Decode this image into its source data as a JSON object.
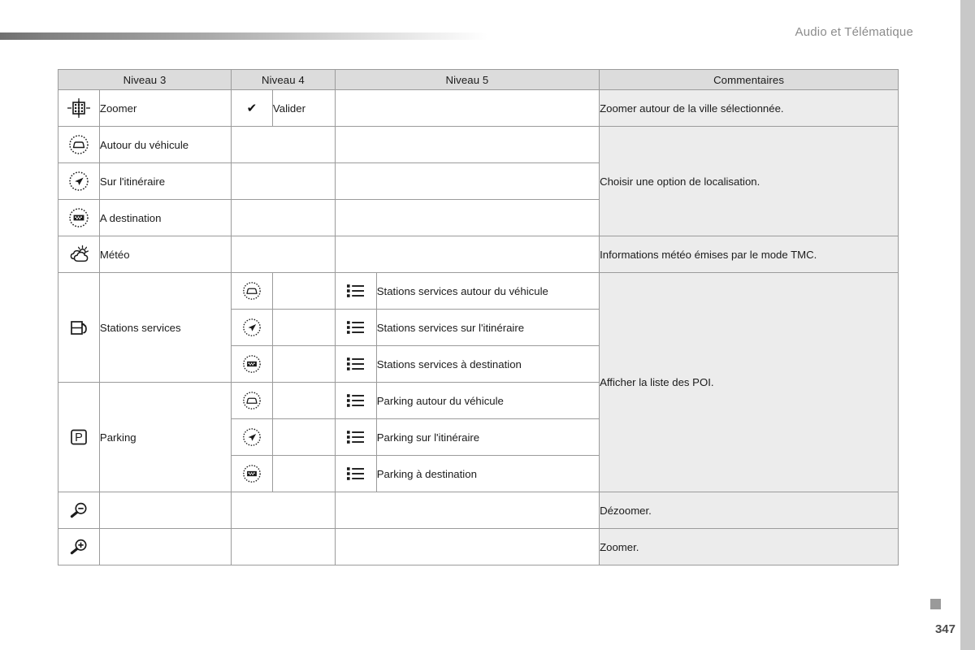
{
  "header": {
    "title": "Audio et Télématique"
  },
  "footer": {
    "page_number": "347"
  },
  "table": {
    "columns": [
      "Niveau 3",
      "Niveau 4",
      "Niveau 5",
      "Commentaires"
    ],
    "rows": [
      {
        "n3_icon": "zoom-city-icon",
        "n3_label": "Zoomer",
        "n4_icon": "check-icon",
        "n4_label": "Valider",
        "n5_icon": "",
        "n5_label": "",
        "comment": "Zoomer autour de la ville sélectionnée."
      },
      {
        "n3_icon": "vehicle-around-icon",
        "n3_label": "Autour du véhicule",
        "n4_icon": "",
        "n4_label": "",
        "n5_icon": "",
        "n5_label": "",
        "comment": "Choisir une option de localisation."
      },
      {
        "n3_icon": "route-arrow-icon",
        "n3_label": "Sur l'itinéraire",
        "n4_icon": "",
        "n4_label": "",
        "n5_icon": "",
        "n5_label": "",
        "comment": ""
      },
      {
        "n3_icon": "destination-flag-icon",
        "n3_label": "A destination",
        "n4_icon": "",
        "n4_label": "",
        "n5_icon": "",
        "n5_label": "",
        "comment": ""
      },
      {
        "n3_icon": "weather-icon",
        "n3_label": "Météo",
        "n4_icon": "",
        "n4_label": "",
        "n5_icon": "",
        "n5_label": "",
        "comment": "Informations météo émises par le mode TMC."
      },
      {
        "n3_icon": "fuel-pump-icon",
        "n3_label": "Stations services",
        "n4_icon": "vehicle-around-icon",
        "n4_label": "",
        "n5_icon": "list-icon",
        "n5_label": "Stations services autour du véhicule",
        "comment": "Afficher la liste des POI."
      },
      {
        "n3_icon": "",
        "n3_label": "",
        "n4_icon": "route-arrow-icon",
        "n4_label": "",
        "n5_icon": "list-icon",
        "n5_label": "Stations services sur l'itinéraire",
        "comment": ""
      },
      {
        "n3_icon": "",
        "n3_label": "",
        "n4_icon": "destination-flag-icon",
        "n4_label": "",
        "n5_icon": "list-icon",
        "n5_label": "Stations services à destination",
        "comment": ""
      },
      {
        "n3_icon": "parking-icon",
        "n3_label": "Parking",
        "n4_icon": "vehicle-around-icon",
        "n4_label": "",
        "n5_icon": "list-icon",
        "n5_label": "Parking autour du véhicule",
        "comment": ""
      },
      {
        "n3_icon": "",
        "n3_label": "",
        "n4_icon": "route-arrow-icon",
        "n4_label": "",
        "n5_icon": "list-icon",
        "n5_label": "Parking sur l'itinéraire",
        "comment": ""
      },
      {
        "n3_icon": "",
        "n3_label": "",
        "n4_icon": "destination-flag-icon",
        "n4_label": "",
        "n5_icon": "list-icon",
        "n5_label": "Parking à destination",
        "comment": ""
      },
      {
        "n3_icon": "zoom-out-icon",
        "n3_label": "",
        "n4_icon": "",
        "n4_label": "",
        "n5_icon": "",
        "n5_label": "",
        "comment": "Dézoomer."
      },
      {
        "n3_icon": "zoom-in-icon",
        "n3_label": "",
        "n4_icon": "",
        "n4_label": "",
        "n5_icon": "",
        "n5_label": "",
        "comment": "Zoomer."
      }
    ]
  },
  "colors": {
    "header_band": "#dcdcdc",
    "comment_bg": "#ececec",
    "border": "#9b9b9b",
    "edge_strip": "#c8c8c8",
    "header_text": "#8c8c8c"
  }
}
